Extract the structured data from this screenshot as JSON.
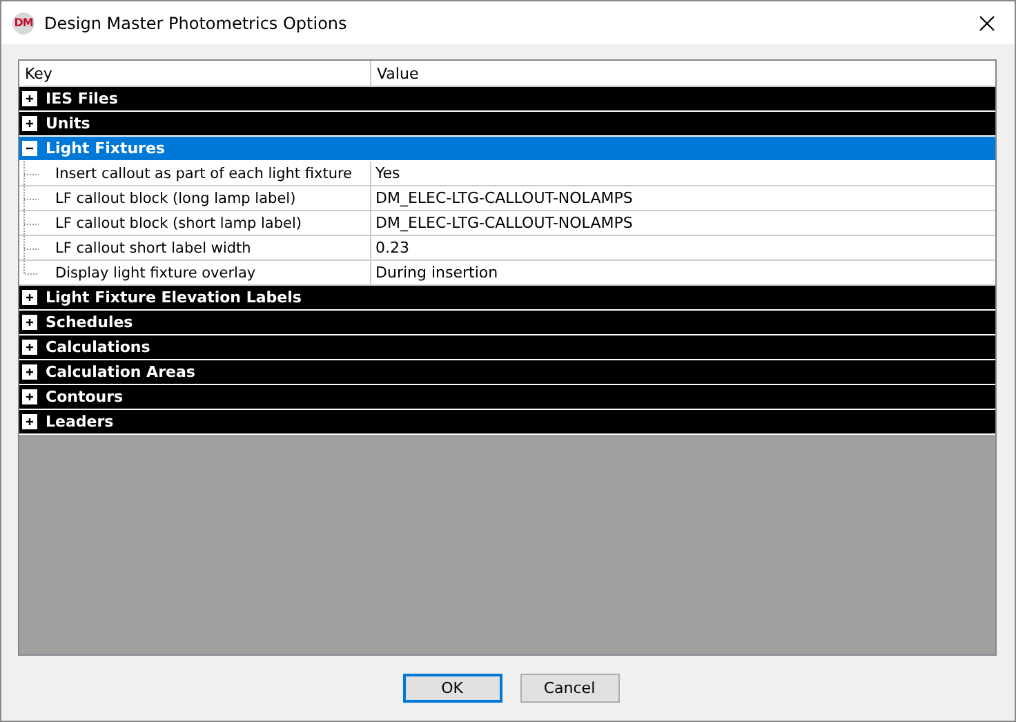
{
  "window": {
    "title": "Design Master Photometrics Options",
    "logo_text": "DM"
  },
  "grid": {
    "columns": [
      "Key",
      "Value"
    ],
    "categories": [
      {
        "name": "IES Files",
        "expanded": false,
        "selected": false
      },
      {
        "name": "Units",
        "expanded": false,
        "selected": false
      },
      {
        "name": "Light Fixtures",
        "expanded": true,
        "selected": true,
        "properties": [
          {
            "key": "Insert callout as part of each light fixture",
            "value": "Yes"
          },
          {
            "key": "LF callout block (long lamp label)",
            "value": "DM_ELEC-LTG-CALLOUT-NOLAMPS"
          },
          {
            "key": "LF callout block (short lamp label)",
            "value": "DM_ELEC-LTG-CALLOUT-NOLAMPS"
          },
          {
            "key": "LF callout short label width",
            "value": "0.23"
          },
          {
            "key": "Display light fixture overlay",
            "value": "During insertion"
          }
        ]
      },
      {
        "name": "Light Fixture Elevation Labels",
        "expanded": false,
        "selected": false
      },
      {
        "name": "Schedules",
        "expanded": false,
        "selected": false
      },
      {
        "name": "Calculations",
        "expanded": false,
        "selected": false
      },
      {
        "name": "Calculation Areas",
        "expanded": false,
        "selected": false
      },
      {
        "name": "Contours",
        "expanded": false,
        "selected": false
      },
      {
        "name": "Leaders",
        "expanded": false,
        "selected": false
      }
    ]
  },
  "buttons": [
    {
      "label": "OK",
      "default": true
    },
    {
      "label": "Cancel",
      "default": false
    }
  ]
}
